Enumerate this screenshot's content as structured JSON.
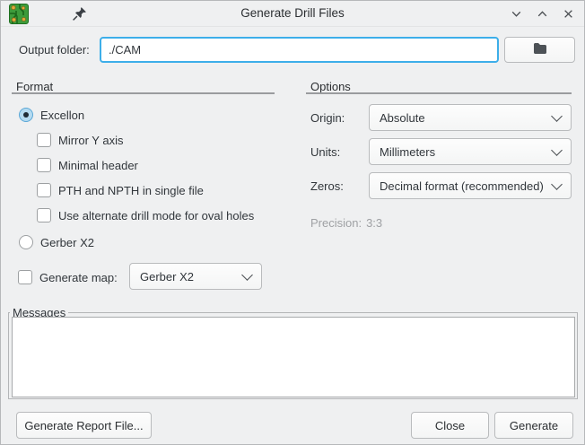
{
  "window": {
    "title": "Generate Drill Files"
  },
  "output_folder": {
    "label": "Output folder:",
    "value": "./CAM"
  },
  "format": {
    "title": "Format",
    "radios": [
      {
        "label": "Excellon",
        "selected": true
      },
      {
        "label": "Gerber X2",
        "selected": false
      }
    ],
    "checkboxes": [
      {
        "label": "Mirror Y axis",
        "checked": false
      },
      {
        "label": "Minimal header",
        "checked": false
      },
      {
        "label": "PTH and NPTH in single file",
        "checked": false
      },
      {
        "label": "Use alternate drill mode for oval holes",
        "checked": false
      }
    ],
    "generate_map": {
      "label": "Generate map:",
      "checked": false,
      "value": "Gerber X2"
    }
  },
  "options": {
    "title": "Options",
    "fields": [
      {
        "label": "Origin:",
        "value": "Absolute"
      },
      {
        "label": "Units:",
        "value": "Millimeters"
      },
      {
        "label": "Zeros:",
        "value": "Decimal format (recommended)"
      }
    ],
    "precision_label": "Precision:",
    "precision_value": "3:3"
  },
  "messages": {
    "title": "Messages",
    "content": ""
  },
  "actions": {
    "report": "Generate Report File...",
    "close": "Close",
    "generate": "Generate"
  },
  "colors": {
    "accent": "#3daee9",
    "background": "#eff0f1",
    "text": "#31363b",
    "disabled_text": "#9fa1a4"
  }
}
